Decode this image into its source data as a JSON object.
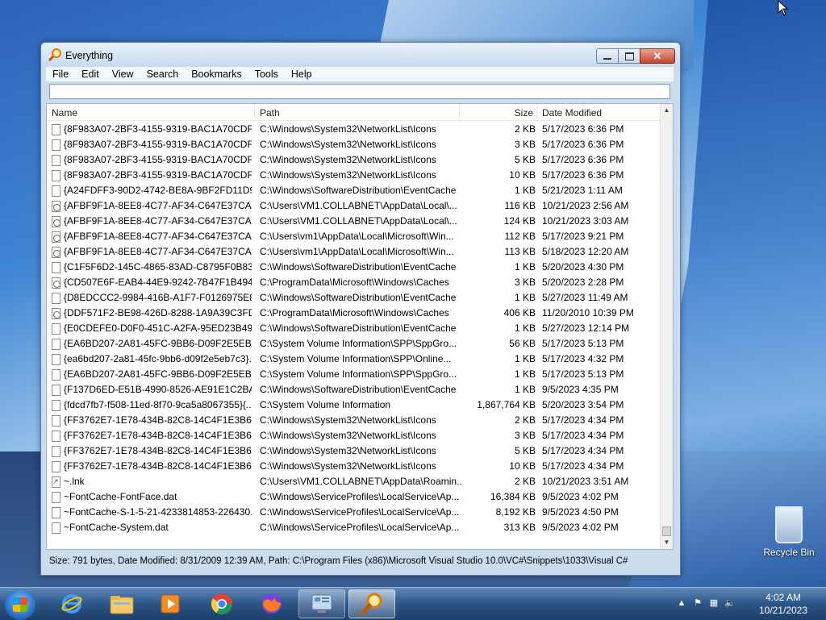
{
  "window": {
    "title": "Everything",
    "menus": [
      "File",
      "Edit",
      "View",
      "Search",
      "Bookmarks",
      "Tools",
      "Help"
    ],
    "search": {
      "value": "",
      "placeholder": ""
    },
    "columns": {
      "name": "Name",
      "path": "Path",
      "size": "Size",
      "date": "Date Modified"
    },
    "rows": [
      {
        "icon": "file",
        "name": "{8F983A07-2BF3-4155-9319-BAC1A70CDF...",
        "path": "C:\\Windows\\System32\\NetworkList\\Icons",
        "size": "2 KB",
        "date": "5/17/2023 6:36 PM"
      },
      {
        "icon": "file",
        "name": "{8F983A07-2BF3-4155-9319-BAC1A70CDF...",
        "path": "C:\\Windows\\System32\\NetworkList\\Icons",
        "size": "3 KB",
        "date": "5/17/2023 6:36 PM"
      },
      {
        "icon": "file",
        "name": "{8F983A07-2BF3-4155-9319-BAC1A70CDF...",
        "path": "C:\\Windows\\System32\\NetworkList\\Icons",
        "size": "5 KB",
        "date": "5/17/2023 6:36 PM"
      },
      {
        "icon": "file",
        "name": "{8F983A07-2BF3-4155-9319-BAC1A70CDF...",
        "path": "C:\\Windows\\System32\\NetworkList\\Icons",
        "size": "10 KB",
        "date": "5/17/2023 6:36 PM"
      },
      {
        "icon": "file",
        "name": "{A24FDFF3-90D2-4742-BE8A-9BF2FD11D9...",
        "path": "C:\\Windows\\SoftwareDistribution\\EventCache",
        "size": "1 KB",
        "date": "5/21/2023 1:11 AM"
      },
      {
        "icon": "system",
        "name": "{AFBF9F1A-8EE8-4C77-AF34-C647E37CA0...",
        "path": "C:\\Users\\VM1.COLLABNET\\AppData\\Local\\...",
        "size": "116 KB",
        "date": "10/21/2023 2:56 AM"
      },
      {
        "icon": "system",
        "name": "{AFBF9F1A-8EE8-4C77-AF34-C647E37CA0...",
        "path": "C:\\Users\\VM1.COLLABNET\\AppData\\Local\\...",
        "size": "124 KB",
        "date": "10/21/2023 3:03 AM"
      },
      {
        "icon": "system",
        "name": "{AFBF9F1A-8EE8-4C77-AF34-C647E37CA0...",
        "path": "C:\\Users\\vm1\\AppData\\Local\\Microsoft\\Win...",
        "size": "112 KB",
        "date": "5/17/2023 9:21 PM"
      },
      {
        "icon": "system",
        "name": "{AFBF9F1A-8EE8-4C77-AF34-C647E37CA0...",
        "path": "C:\\Users\\vm1\\AppData\\Local\\Microsoft\\Win...",
        "size": "113 KB",
        "date": "5/18/2023 12:20 AM"
      },
      {
        "icon": "file",
        "name": "{C1F5F6D2-145C-4865-83AD-C8795F0B838...",
        "path": "C:\\Windows\\SoftwareDistribution\\EventCache",
        "size": "1 KB",
        "date": "5/20/2023 4:30 PM"
      },
      {
        "icon": "system",
        "name": "{CD507E6F-EAB4-44E9-9242-7B47F1B4940...",
        "path": "C:\\ProgramData\\Microsoft\\Windows\\Caches",
        "size": "3 KB",
        "date": "5/20/2023 2:28 PM"
      },
      {
        "icon": "file",
        "name": "{D8EDCCC2-9984-416B-A1F7-F0126975E8F...",
        "path": "C:\\Windows\\SoftwareDistribution\\EventCache",
        "size": "1 KB",
        "date": "5/27/2023 11:49 AM"
      },
      {
        "icon": "system",
        "name": "{DDF571F2-BE98-426D-8288-1A9A39C3FD...",
        "path": "C:\\ProgramData\\Microsoft\\Windows\\Caches",
        "size": "406 KB",
        "date": "11/20/2010 10:39 PM"
      },
      {
        "icon": "file",
        "name": "{E0CDEFE0-D0F0-451C-A2FA-95ED23B496...",
        "path": "C:\\Windows\\SoftwareDistribution\\EventCache",
        "size": "1 KB",
        "date": "5/27/2023 12:14 PM"
      },
      {
        "icon": "file",
        "name": "{EA6BD207-2A81-45FC-9BB6-D09F2E5EB7...",
        "path": "C:\\System Volume Information\\SPP\\SppGro...",
        "size": "56 KB",
        "date": "5/17/2023 5:13 PM"
      },
      {
        "icon": "file",
        "name": "{ea6bd207-2a81-45fc-9bb6-d09f2e5eb7c3}...",
        "path": "C:\\System Volume Information\\SPP\\Online...",
        "size": "1 KB",
        "date": "5/17/2023 4:32 PM"
      },
      {
        "icon": "file",
        "name": "{EA6BD207-2A81-45FC-9BB6-D09F2E5EB7...",
        "path": "C:\\System Volume Information\\SPP\\SppGro...",
        "size": "1 KB",
        "date": "5/17/2023 5:13 PM"
      },
      {
        "icon": "file",
        "name": "{F137D6ED-E51B-4990-8526-AE91E1C2BA4...",
        "path": "C:\\Windows\\SoftwareDistribution\\EventCache",
        "size": "1 KB",
        "date": "9/5/2023 4:35 PM"
      },
      {
        "icon": "file",
        "name": "{fdcd7fb7-f508-11ed-8f70-9ca5a8067355}{...",
        "path": "C:\\System Volume Information",
        "size": "1,867,764 KB",
        "date": "5/20/2023 3:54 PM"
      },
      {
        "icon": "file",
        "name": "{FF3762E7-1E78-434B-82C8-14C4F1E3B6A...",
        "path": "C:\\Windows\\System32\\NetworkList\\Icons",
        "size": "2 KB",
        "date": "5/17/2023 4:34 PM"
      },
      {
        "icon": "file",
        "name": "{FF3762E7-1E78-434B-82C8-14C4F1E3B6A...",
        "path": "C:\\Windows\\System32\\NetworkList\\Icons",
        "size": "3 KB",
        "date": "5/17/2023 4:34 PM"
      },
      {
        "icon": "file",
        "name": "{FF3762E7-1E78-434B-82C8-14C4F1E3B6A...",
        "path": "C:\\Windows\\System32\\NetworkList\\Icons",
        "size": "5 KB",
        "date": "5/17/2023 4:34 PM"
      },
      {
        "icon": "file",
        "name": "{FF3762E7-1E78-434B-82C8-14C4F1E3B6A...",
        "path": "C:\\Windows\\System32\\NetworkList\\Icons",
        "size": "10 KB",
        "date": "5/17/2023 4:34 PM"
      },
      {
        "icon": "shortcut",
        "name": "~.lnk",
        "path": "C:\\Users\\VM1.COLLABNET\\AppData\\Roamin...",
        "size": "2 KB",
        "date": "10/21/2023 3:51 AM"
      },
      {
        "icon": "file",
        "name": "~FontCache-FontFace.dat",
        "path": "C:\\Windows\\ServiceProfiles\\LocalService\\Ap...",
        "size": "16,384 KB",
        "date": "9/5/2023 4:02 PM"
      },
      {
        "icon": "file",
        "name": "~FontCache-S-1-5-21-4233814853-226430...",
        "path": "C:\\Windows\\ServiceProfiles\\LocalService\\Ap...",
        "size": "8,192 KB",
        "date": "9/5/2023 4:50 PM"
      },
      {
        "icon": "file",
        "name": "~FontCache-System.dat",
        "path": "C:\\Windows\\ServiceProfiles\\LocalService\\Ap...",
        "size": "313 KB",
        "date": "9/5/2023 4:02 PM"
      }
    ],
    "scroll_position": 1.0,
    "status": "Size: 791 bytes, Date Modified: 8/31/2009 12:39 AM, Path: C:\\Program Files (x86)\\Microsoft Visual Studio 10.0\\VC#\\Snippets\\1033\\Visual C#"
  },
  "desktop": {
    "recycle_bin_label": "Recycle Bin"
  },
  "taskbar": {
    "apps": [
      "internet-explorer-icon",
      "file-explorer-icon",
      "media-player-icon",
      "chrome-icon",
      "firefox-icon",
      "control-panel-icon",
      "everything-search-icon"
    ],
    "clock_time": "4:02 AM",
    "clock_date": "10/21/2023"
  },
  "colors": {
    "accent": "#2b5587",
    "close_button": "#c7452d"
  }
}
